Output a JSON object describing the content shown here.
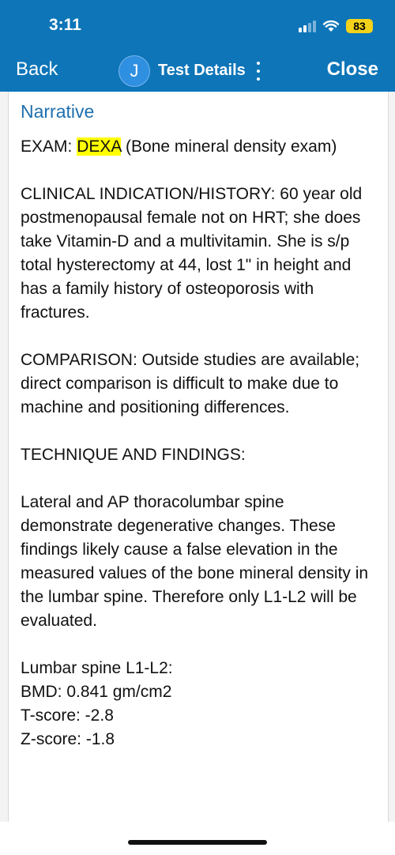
{
  "status": {
    "time": "3:11",
    "battery": "83"
  },
  "nav": {
    "back": "Back",
    "avatar": "J",
    "title": "Test Details",
    "close": "Close"
  },
  "content": {
    "heading": "Narrative",
    "exam_prefix": "EXAM: ",
    "exam_highlight": "DEXA",
    "exam_rest": " (Bone mineral density exam)",
    "clinical": "CLINICAL INDICATION/HISTORY: 60 year old postmenopausal female not on HRT; she does take Vitamin-D and a multivitamin. She is s/p total hysterectomy at 44, lost 1\" in height and has a family history of osteoporosis with fractures.",
    "comparison": "COMPARISON: Outside studies are available; direct comparison is difficult to make due to machine and positioning differences.",
    "technique": "TECHNIQUE AND FINDINGS:",
    "findings": "Lateral and AP thoracolumbar spine demonstrate degenerative changes. These findings likely cause a false elevation in the measured values of the bone mineral density in the lumbar spine. Therefore only L1-L2 will be evaluated.",
    "lumbar": {
      "title": "Lumbar spine L1-L2:",
      "bmd": "BMD: 0.841 gm/cm2",
      "tscore": "T-score: -2.8",
      "zscore": "Z-score: -1.8"
    }
  }
}
